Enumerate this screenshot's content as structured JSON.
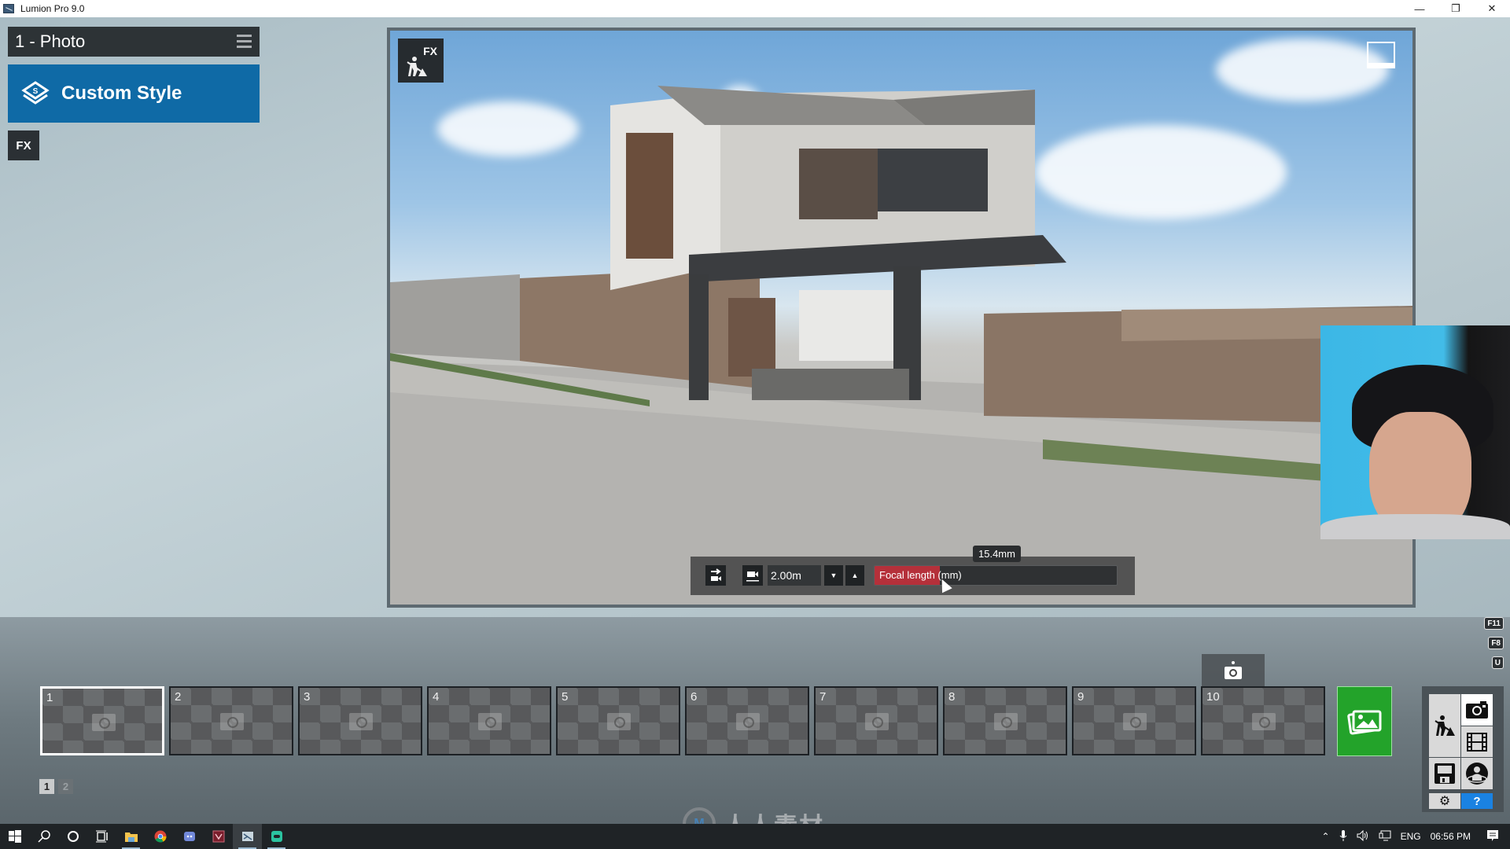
{
  "window": {
    "title": "Lumion Pro 9.0",
    "controls": [
      "minimize",
      "restore",
      "close"
    ],
    "control_glyphs": {
      "minimize": "—",
      "restore": "❐",
      "close": "✕"
    }
  },
  "left_panel": {
    "mode_title": "1 - Photo",
    "style_button_label": "Custom Style",
    "style_icon_letter": "S",
    "fx_button_label": "FX"
  },
  "viewport": {
    "fx_button_label": "FX",
    "camera_bar": {
      "camera_height_value": "2.00m",
      "focal_length_label": "Focal length (mm)",
      "focal_length_value": "15.4mm",
      "focal_length_fraction": 0.27,
      "step_down_glyph": "▼",
      "step_up_glyph": "▲"
    }
  },
  "function_keys": [
    "F11",
    "F8",
    "U"
  ],
  "photo_set": {
    "slots": [
      {
        "number": "1",
        "selected": true
      },
      {
        "number": "2",
        "selected": false
      },
      {
        "number": "3",
        "selected": false
      },
      {
        "number": "4",
        "selected": false
      },
      {
        "number": "5",
        "selected": false
      },
      {
        "number": "6",
        "selected": false
      },
      {
        "number": "7",
        "selected": false
      },
      {
        "number": "8",
        "selected": false
      },
      {
        "number": "9",
        "selected": false
      },
      {
        "number": "10",
        "selected": false
      }
    ],
    "pages": [
      {
        "label": "1",
        "active": true
      },
      {
        "label": "2",
        "active": false
      }
    ]
  },
  "mode_palette": {
    "items": [
      "build-mode",
      "photo-mode",
      "movie-mode",
      "save",
      "360-panorama",
      "settings",
      "help"
    ],
    "help_label": "?",
    "settings_glyph": "⚙",
    "accent_help": "#1a82e2",
    "accent_render": "#23a32a"
  },
  "watermark": {
    "logo_letters": "M",
    "text": "人人素材"
  },
  "taskbar": {
    "apps": [
      "start",
      "search",
      "cortana",
      "task-view",
      "file-explorer",
      "chrome",
      "discord",
      "app-red",
      "lumion",
      "app-green"
    ],
    "tray": {
      "language": "ENG",
      "time": "06:56 PM"
    }
  }
}
